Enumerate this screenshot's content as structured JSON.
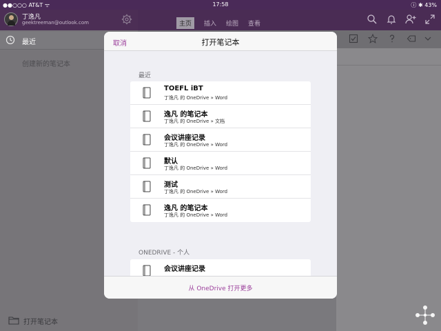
{
  "status": {
    "carrier": "●●○○○ AT&T ᯤ",
    "time": "17:58",
    "battery": "ⓘ ✱ 43%"
  },
  "account": {
    "name": "丁逸凡",
    "email": "geektreeman@outlook.com"
  },
  "sidebar": {
    "recent_label": "最近",
    "create_label": "创建新的笔记本",
    "open_label": "打开笔记本"
  },
  "ribbon": {
    "tabs": [
      {
        "label": "主页",
        "active": true
      },
      {
        "label": "插入",
        "active": false
      },
      {
        "label": "绘图",
        "active": false
      },
      {
        "label": "查看",
        "active": false
      }
    ]
  },
  "dialog": {
    "cancel": "取消",
    "title": "打开笔记本",
    "recent_header": "最近",
    "recent_items": [
      {
        "title": "TOEFL iBT",
        "subtitle": "丁逸凡 的 OneDrive » Word"
      },
      {
        "title": "逸凡 的笔记本",
        "subtitle": "丁逸凡 的 OneDrive » 文档"
      },
      {
        "title": "会议讲座记录",
        "subtitle": "丁逸凡 的 OneDrive » Word"
      },
      {
        "title": "默认",
        "subtitle": "丁逸凡 的 OneDrive » Word"
      },
      {
        "title": "测试",
        "subtitle": "丁逸凡 的 OneDrive » Word"
      },
      {
        "title": "逸凡 的笔记本",
        "subtitle": "丁逸凡 的 OneDrive » Word"
      }
    ],
    "onedrive_header": "ONEDRIVE - 个人",
    "onedrive_items": [
      {
        "title": "会议讲座记录",
        "subtitle": ""
      }
    ],
    "footer": "从 OneDrive 打开更多"
  },
  "colors": {
    "accent": "#9b3f9b",
    "header_purple": "#4a2c54"
  }
}
